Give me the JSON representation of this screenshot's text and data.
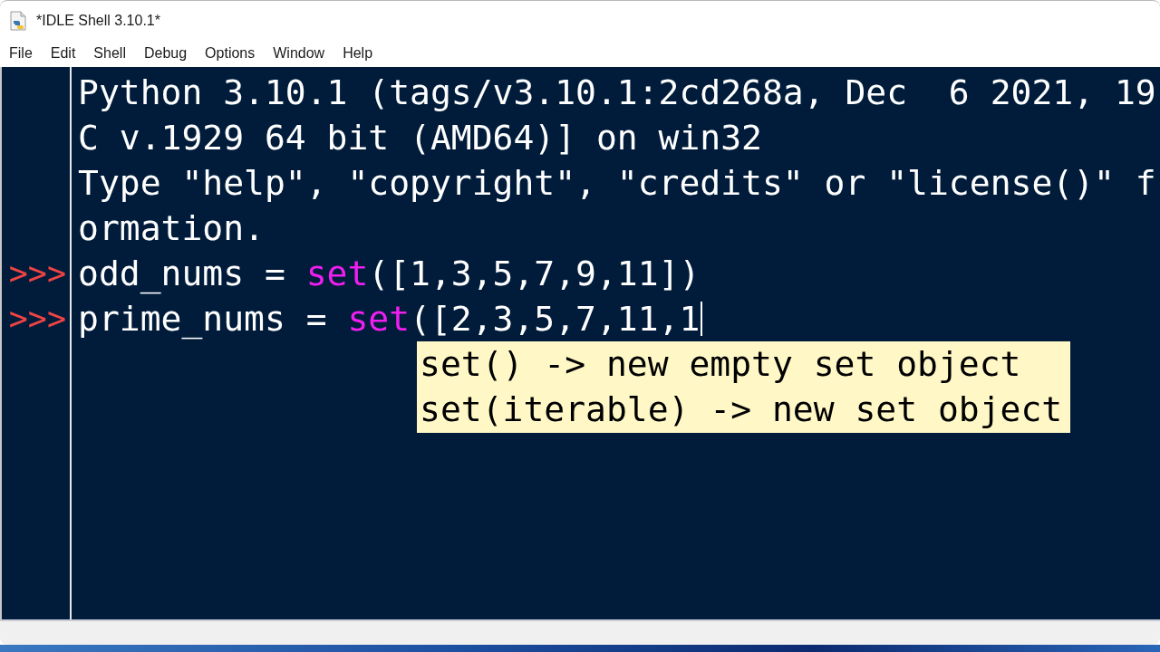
{
  "window": {
    "title": "*IDLE Shell 3.10.1*"
  },
  "menu_bar": [
    "File",
    "Edit",
    "Shell",
    "Debug",
    "Options",
    "Window",
    "Help"
  ],
  "shell": {
    "lines": [
      {
        "segments": [
          {
            "kind": "plain",
            "text": "Python 3.10.1 (tags/v3.10.1:2cd268a, Dec  6 2021, 19"
          }
        ],
        "cursor": false
      },
      {
        "segments": [
          {
            "kind": "plain",
            "text": "C v.1929 64 bit (AMD64)] on win32"
          }
        ],
        "cursor": false
      },
      {
        "segments": [
          {
            "kind": "plain",
            "text": "Type \"help\", \"copyright\", \"credits\" or \"license()\" f"
          }
        ],
        "cursor": false
      },
      {
        "segments": [
          {
            "kind": "plain",
            "text": "ormation."
          }
        ],
        "cursor": false
      },
      {
        "prompt": ">>>",
        "segments": [
          {
            "kind": "plain",
            "text": "odd_nums = "
          },
          {
            "kind": "builtin",
            "text": "set"
          },
          {
            "kind": "plain",
            "text": "([1,3,5,7,9,11])"
          }
        ],
        "cursor": false
      },
      {
        "prompt": ">>>",
        "segments": [
          {
            "kind": "plain",
            "text": "prime_nums = "
          },
          {
            "kind": "builtin",
            "text": "set"
          },
          {
            "kind": "plain",
            "text": "([2,3,5,7,11,1"
          }
        ],
        "cursor": true
      }
    ],
    "calltip": [
      "set() -> new empty set object",
      "set(iterable) -> new set object"
    ]
  }
}
